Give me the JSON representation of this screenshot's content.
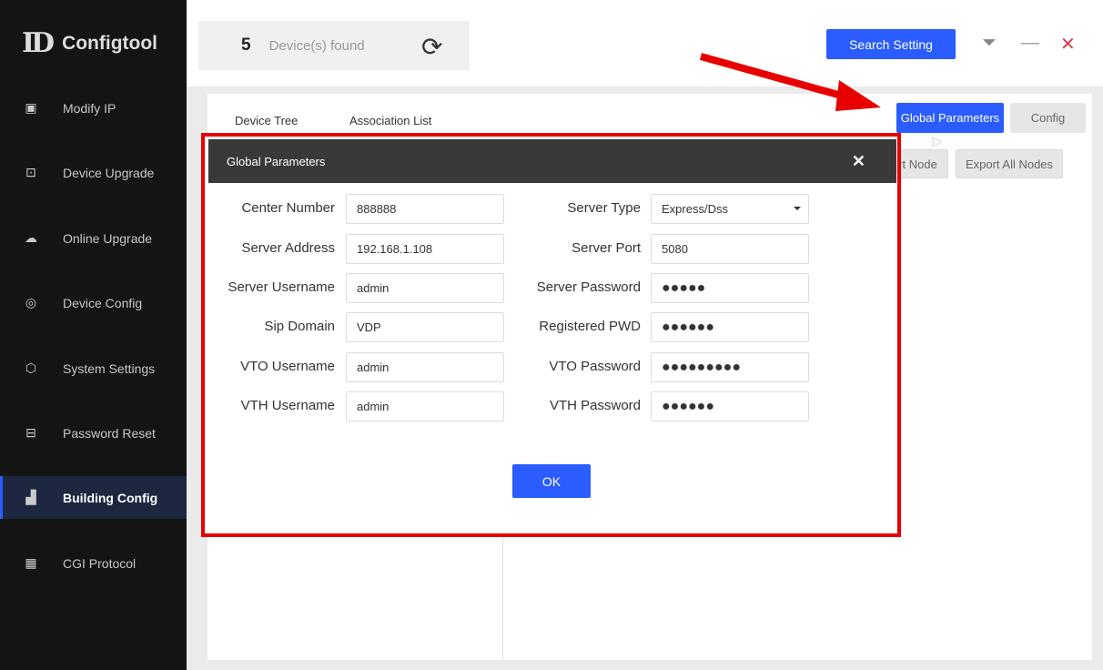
{
  "app": {
    "title": "Configtool"
  },
  "sidebar": {
    "items": [
      {
        "label": "Modify IP",
        "icon": "ip-icon"
      },
      {
        "label": "Device Upgrade",
        "icon": "upgrade-icon"
      },
      {
        "label": "Online Upgrade",
        "icon": "cloud-upgrade-icon"
      },
      {
        "label": "Device Config",
        "icon": "config-icon"
      },
      {
        "label": "System Settings",
        "icon": "settings-icon"
      },
      {
        "label": "Password Reset",
        "icon": "lock-icon"
      },
      {
        "label": "Building Config",
        "icon": "building-icon",
        "active": true
      },
      {
        "label": "CGI Protocol",
        "icon": "qr-icon"
      }
    ]
  },
  "header": {
    "device_count": "5",
    "device_label": "Device(s) found",
    "search_setting": "Search Setting"
  },
  "tabs": [
    "Device Tree",
    "Association List"
  ],
  "toolbar": {
    "global_parameters": "Global Parameters",
    "config": "Config",
    "import_node": "rt Node",
    "export_all": "Export All Nodes"
  },
  "dialog": {
    "title": "Global Parameters",
    "ok": "OK",
    "left": [
      {
        "label": "Center Number",
        "value": "888888"
      },
      {
        "label": "Server Address",
        "value": "192.168.1.108"
      },
      {
        "label": "Server Username",
        "value": "admin"
      },
      {
        "label": "Sip Domain",
        "value": "VDP"
      },
      {
        "label": "VTO Username",
        "value": "admin"
      },
      {
        "label": "VTH Username",
        "value": "admin"
      }
    ],
    "right": [
      {
        "label": "Server Type",
        "value": "Express/Dss"
      },
      {
        "label": "Server Port",
        "value": "5080"
      },
      {
        "label": "Server Password",
        "value": "●●●●●"
      },
      {
        "label": "Registered PWD",
        "value": "●●●●●●"
      },
      {
        "label": "VTO Password",
        "value": "●●●●●●●●●"
      },
      {
        "label": "VTH Password",
        "value": "●●●●●●"
      }
    ]
  },
  "colors": {
    "accent": "#2a5cff",
    "highlight": "#e80000",
    "sidebar": "#141414"
  }
}
